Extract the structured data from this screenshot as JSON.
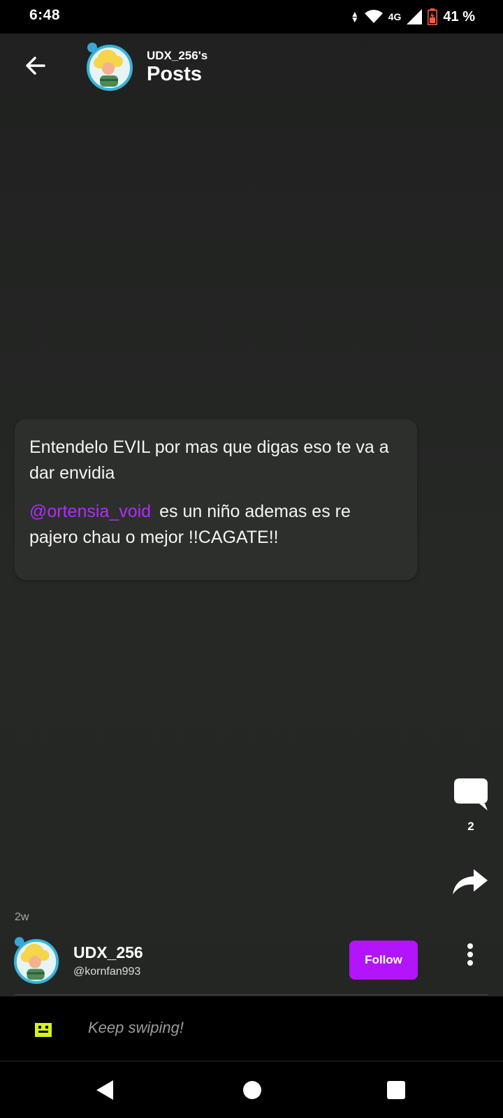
{
  "status_bar": {
    "time": "6:48",
    "network": "4G",
    "battery_percent": "41 %",
    "icons": [
      "data-arrows-icon",
      "wifi-icon",
      "signal-icon",
      "battery-icon"
    ]
  },
  "header": {
    "subtitle": "UDX_256's",
    "title": "Posts",
    "back_icon": "arrow-left-icon"
  },
  "post": {
    "paragraph1": "Entendelo EVIL por mas que digas eso te va a dar envidia",
    "mention": "@ortensia_void",
    "paragraph2_rest": "es un niño ademas es re pajero chau o mejor !!CAGATE!!"
  },
  "actions": {
    "comment_count": "2",
    "comment_icon": "comment-bubble-icon",
    "share_icon": "share-arrow-icon"
  },
  "author": {
    "age": "2w",
    "name": "UDX_256",
    "handle": "@kornfan993",
    "follow_label": "Follow",
    "more_icon": "vertical-dots-icon"
  },
  "swipe_bar": {
    "text": "Keep swiping!",
    "icon": "pixel-face-icon"
  },
  "colors": {
    "accent": "#b214fb",
    "mention": "#b22bff",
    "background": "#242624",
    "card": "#2d2f2c",
    "swipe_icon": "#d6f21b"
  }
}
